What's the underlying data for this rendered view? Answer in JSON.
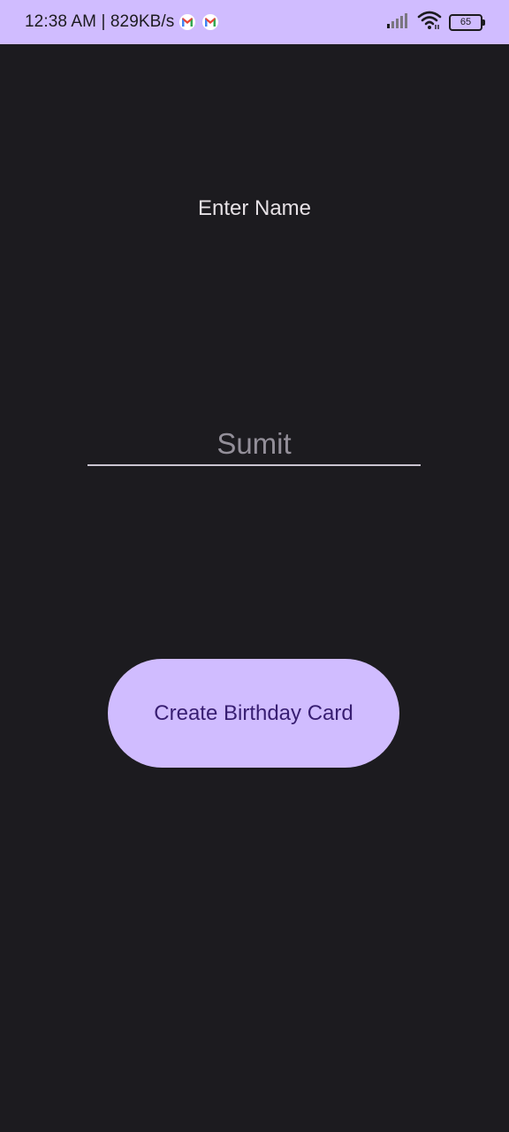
{
  "status_bar": {
    "time_speed": "12:38 AM | 829KB/s",
    "battery_level": "65",
    "icons": [
      "gmail-icon",
      "gmail-icon",
      "signal-icon",
      "wifi-icon",
      "battery-icon"
    ]
  },
  "main": {
    "heading": "Enter Name",
    "name_value": "Sumit",
    "button_label": "Create Birthday Card"
  },
  "colors": {
    "background": "#1c1b1f",
    "accent": "#d0bcff",
    "button_text": "#381e72",
    "text": "#e6e1e5",
    "input_text": "#938f99"
  }
}
